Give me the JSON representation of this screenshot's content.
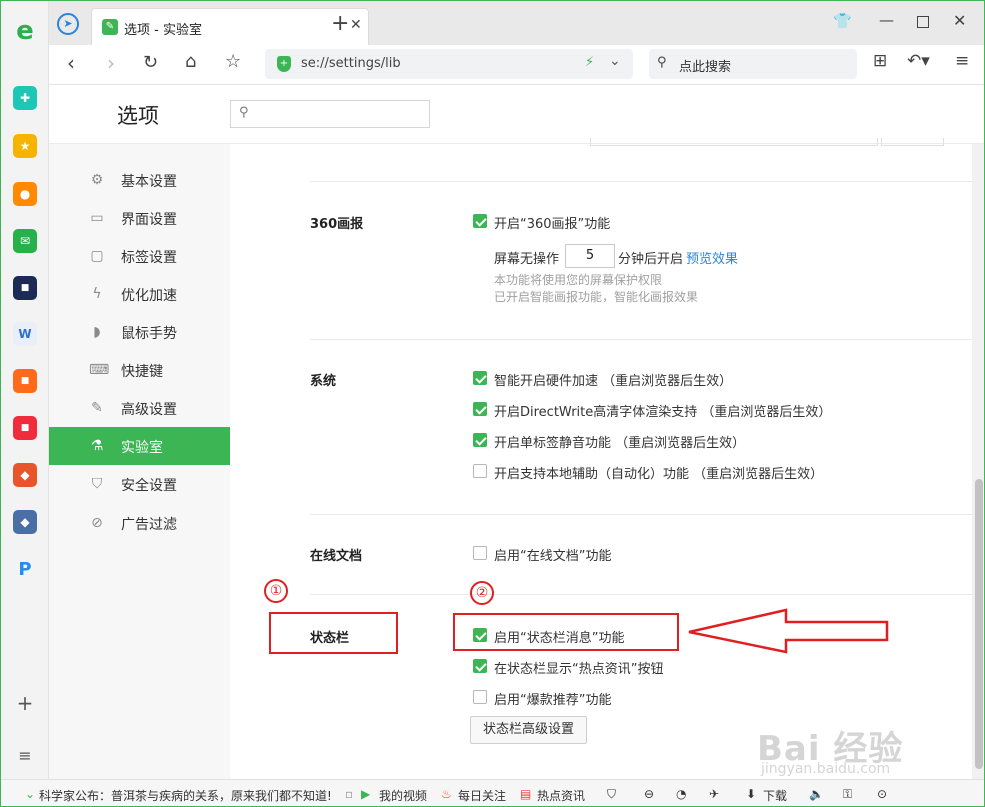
{
  "browser": {
    "tab_title": "选项 - 实验室",
    "url": "se://settings/lib",
    "search_placeholder": "点此搜索"
  },
  "header": {
    "title": "选项"
  },
  "sidebar": {
    "items": [
      {
        "label": "基本设置",
        "icon": "gear-icon"
      },
      {
        "label": "界面设置",
        "icon": "window-icon"
      },
      {
        "label": "标签设置",
        "icon": "tab-icon"
      },
      {
        "label": "优化加速",
        "icon": "lightning-icon"
      },
      {
        "label": "鼠标手势",
        "icon": "mouse-icon"
      },
      {
        "label": "快捷键",
        "icon": "keyboard-icon"
      },
      {
        "label": "高级设置",
        "icon": "wrench-icon"
      },
      {
        "label": "实验室",
        "icon": "flask-icon"
      },
      {
        "label": "安全设置",
        "icon": "shield-icon"
      },
      {
        "label": "广告过滤",
        "icon": "block-icon"
      }
    ]
  },
  "sections": {
    "pictorial": {
      "title": "360画报",
      "enable": "开启“360画报”功能",
      "idle_prefix": "屏幕无操作",
      "idle_value": "5",
      "idle_suffix": "分钟后开启",
      "preview_link": "预览效果",
      "note1": "本功能将使用您的屏幕保护权限",
      "note2": "已开启智能画报功能，智能化画报效果"
    },
    "system": {
      "title": "系统",
      "opt1": "智能开启硬件加速 （重启浏览器后生效）",
      "opt2": "开启DirectWrite高清字体渲染支持 （重启浏览器后生效）",
      "opt3": "开启单标签静音功能 （重启浏览器后生效）",
      "opt4": "开启支持本地辅助（自动化）功能 （重启浏览器后生效）"
    },
    "online_docs": {
      "title": "在线文档",
      "opt1": "启用“在线文档”功能"
    },
    "statusbar": {
      "title": "状态栏",
      "opt1": "启用“状态栏消息”功能",
      "opt2": "在状态栏显示“热点资讯”按钮",
      "opt3": "启用“爆款推荐”功能",
      "advanced_button": "状态栏高级设置"
    }
  },
  "annotations": {
    "marker1": "①",
    "marker2": "②",
    "accent": "#e02020"
  },
  "status_bar": {
    "news": "科学家公布：普洱茶与疾病的关系，原来我们都不知道!",
    "my_video": "我的视频",
    "daily": "每日关注",
    "hot": "热点资讯",
    "download": "下载"
  },
  "colors": {
    "accent": "#3cb554",
    "link": "#2a84d8"
  }
}
